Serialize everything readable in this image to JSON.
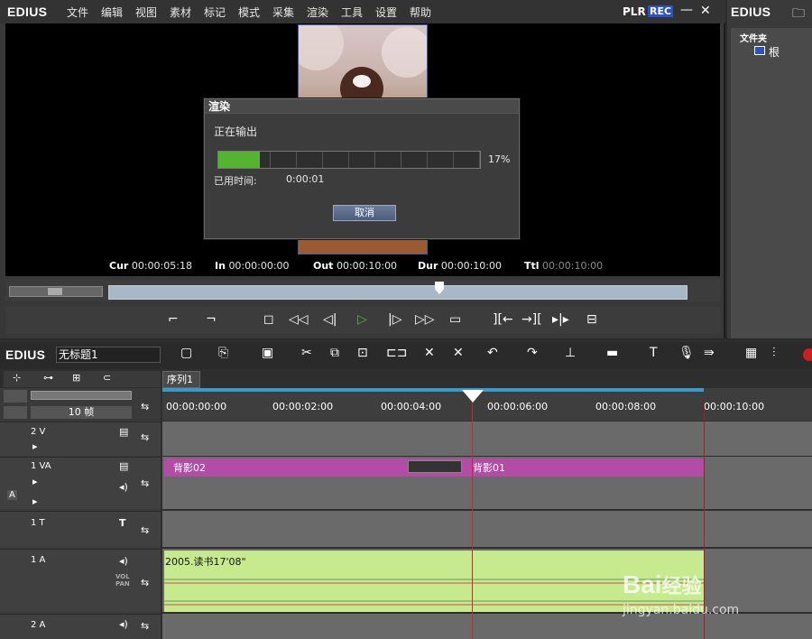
{
  "app": {
    "logo": "EDIUS",
    "bin_logo": "EDIUS",
    "plr": "PLR",
    "rec": "REC",
    "minimize": "—",
    "close": "✕"
  },
  "menu": [
    "文件",
    "编辑",
    "视图",
    "素材",
    "标记",
    "模式",
    "采集",
    "渲染",
    "工具",
    "设置",
    "帮助"
  ],
  "timecodes": {
    "cur_label": "Cur",
    "cur": "00:00:05:18",
    "in_label": "In",
    "in": "00:00:00:00",
    "out_label": "Out",
    "out": "00:00:10:00",
    "dur_label": "Dur",
    "dur": "00:00:10:00",
    "ttl_label": "Ttl",
    "ttl": "00:00:10:00"
  },
  "dialog": {
    "title": "渲染",
    "status": "正在输出",
    "progress_percent": 17,
    "progress_label": "17%",
    "elapsed_label": "已用时间:",
    "elapsed_value": "0:00:01",
    "cancel_label": "取消"
  },
  "bin": {
    "folder_header": "文件夹",
    "root": "根"
  },
  "timeline": {
    "logo": "EDIUS",
    "project_name": "无标题1",
    "sequence_tab": "序列1",
    "zoom": "10 帧",
    "ruler_labels": [
      "00:00:00:00",
      "00:00:02:00",
      "00:00:04:00",
      "00:00:06:00",
      "00:00:08:00",
      "00:00:10:00"
    ],
    "tracks": [
      {
        "name": "2 V"
      },
      {
        "name": "1 VA"
      },
      {
        "name": "1 T"
      },
      {
        "name": "1 A"
      },
      {
        "name": "2 A"
      }
    ],
    "clips": {
      "bg1": "背影02",
      "bg2": "背影01",
      "audio": "2005.读书17'08\""
    },
    "vol_label": "VOL",
    "pan_label": "PAN",
    "a12": "A"
  },
  "watermark": {
    "brand": "Bai",
    "sub": "经验",
    "url": "jingyan.baidu.com"
  }
}
